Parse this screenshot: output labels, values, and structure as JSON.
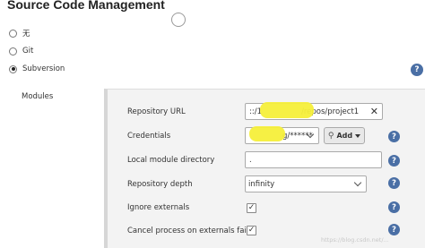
{
  "section": {
    "title": "Source Code Management"
  },
  "scm_options": [
    {
      "label": "无",
      "checked": false
    },
    {
      "label": "Git",
      "checked": false
    },
    {
      "label": "Subversion",
      "checked": true
    }
  ],
  "modules": {
    "label": "Modules",
    "repository_url": {
      "label": "Repository URL",
      "value_prefix": "::/1",
      "value_suffix": "/repos/project1",
      "clear_glyph": "✕"
    },
    "credentials": {
      "label": "Credentials",
      "value": "g/******",
      "add_label": "Add",
      "add_icon": "key-icon"
    },
    "local_module_directory": {
      "label": "Local module directory",
      "value": "."
    },
    "repository_depth": {
      "label": "Repository depth",
      "value": "infinity"
    },
    "ignore_externals": {
      "label": "Ignore externals",
      "checked": true
    },
    "cancel_process_on_externals_fail": {
      "label": "Cancel process on externals fail",
      "checked": true
    }
  },
  "help_glyph": "?",
  "check_glyph": "✓",
  "watermark": "https://blog.csdn.net/..."
}
